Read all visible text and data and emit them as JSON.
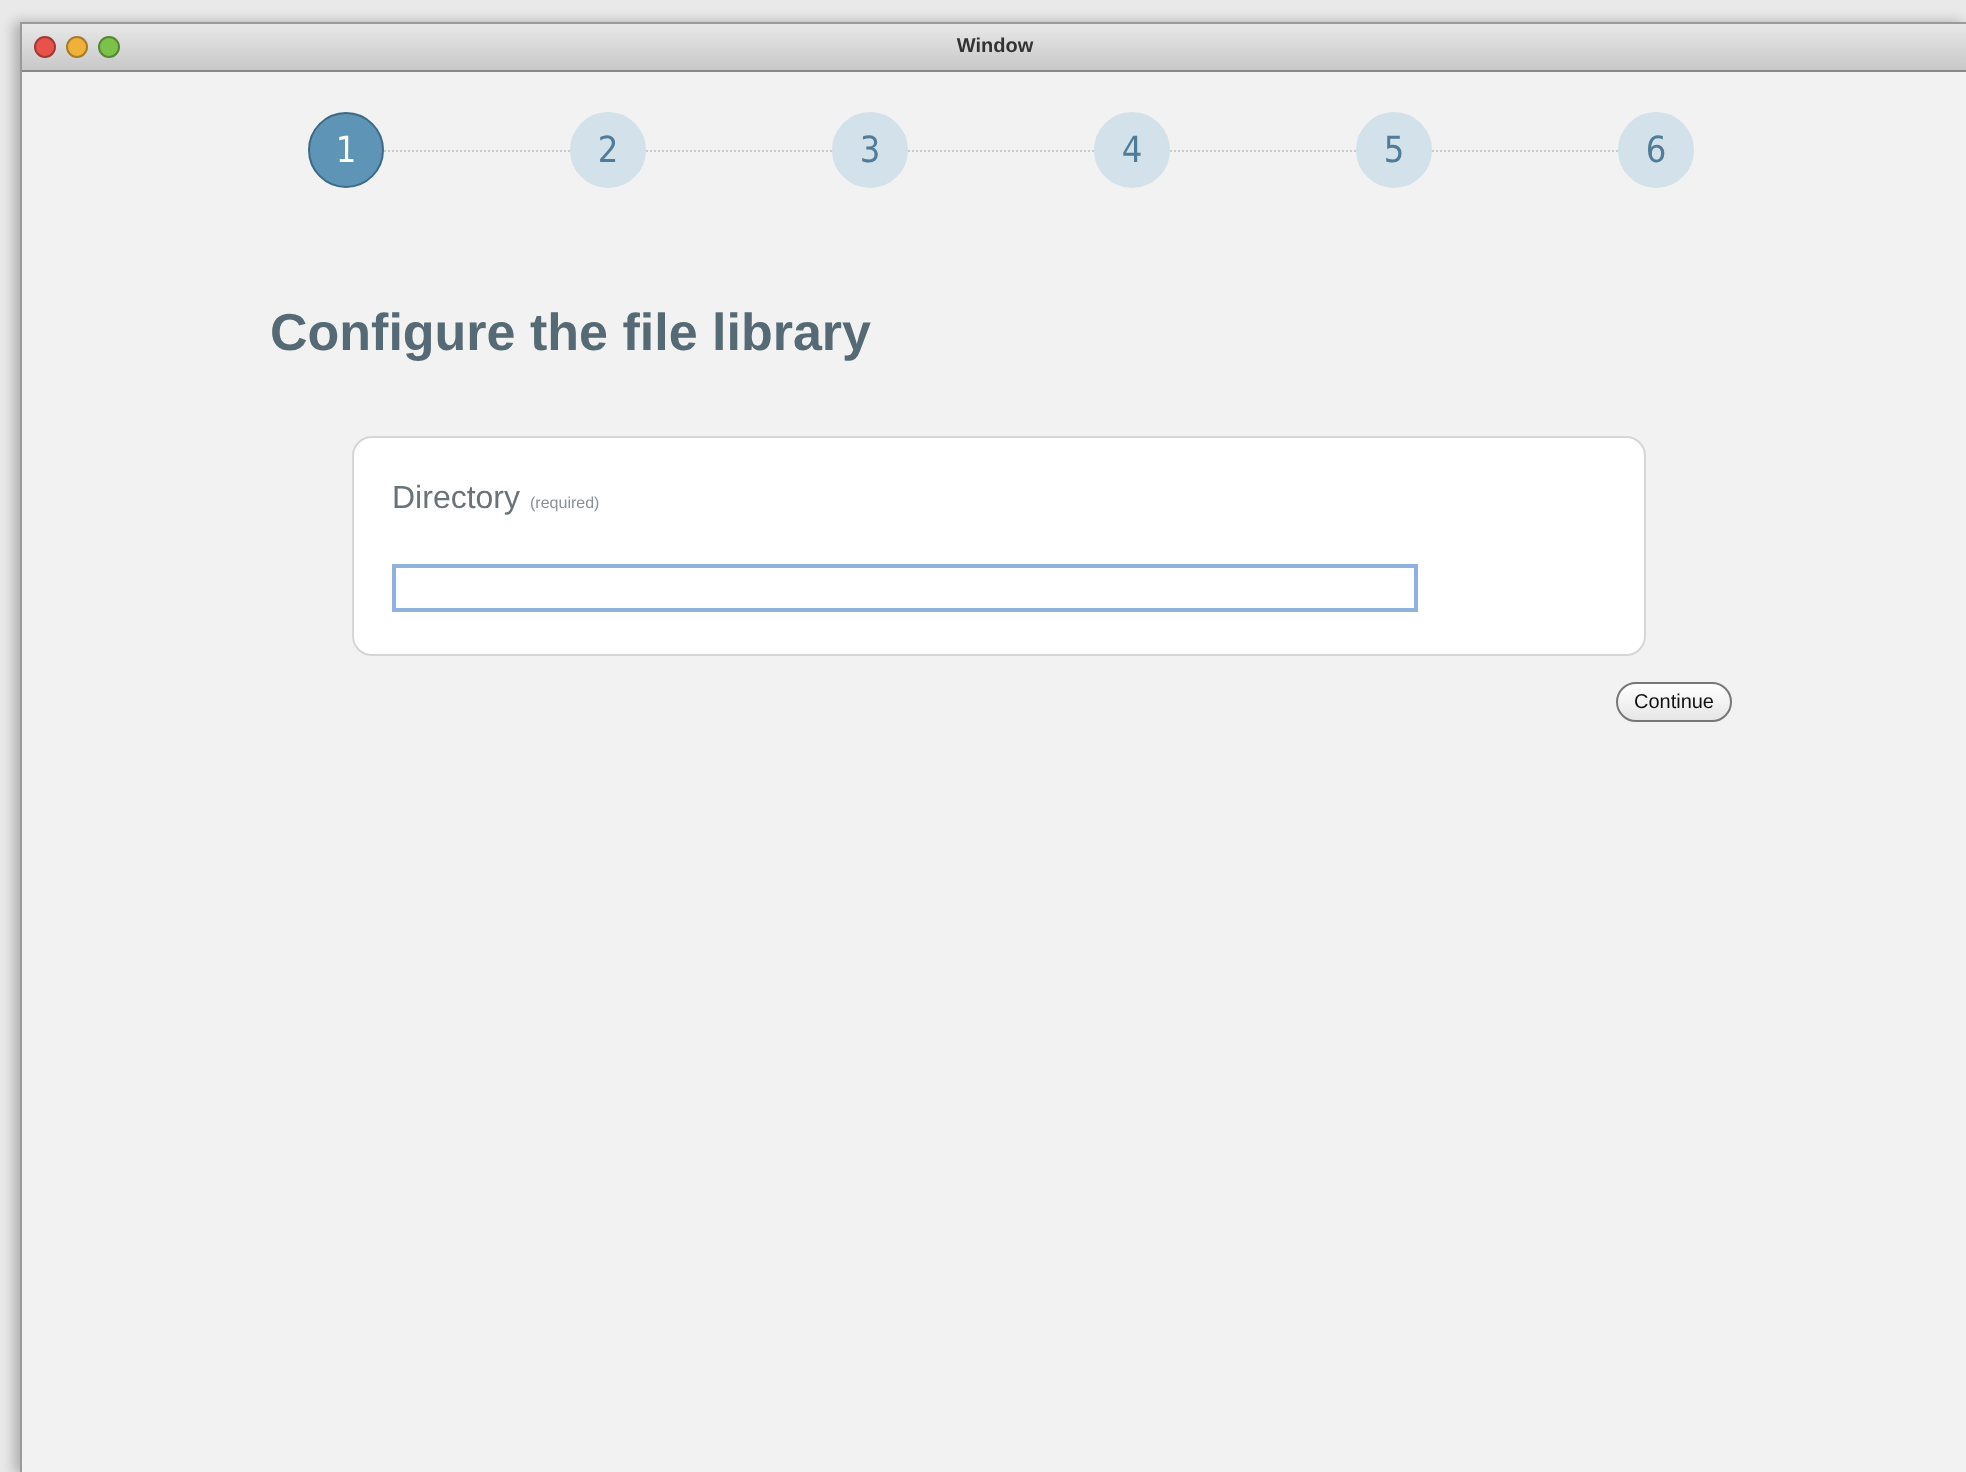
{
  "window": {
    "title": "Window"
  },
  "steps": [
    {
      "label": "1",
      "selected": true
    },
    {
      "label": "2",
      "selected": false
    },
    {
      "label": "3",
      "selected": false
    },
    {
      "label": "4",
      "selected": false
    },
    {
      "label": "5",
      "selected": false
    },
    {
      "label": "6",
      "selected": false
    }
  ],
  "heading": "Configure the file library",
  "field": {
    "label": "Directory",
    "note": "(required)",
    "focused": true
  },
  "buttons": [
    "Continue"
  ]
}
